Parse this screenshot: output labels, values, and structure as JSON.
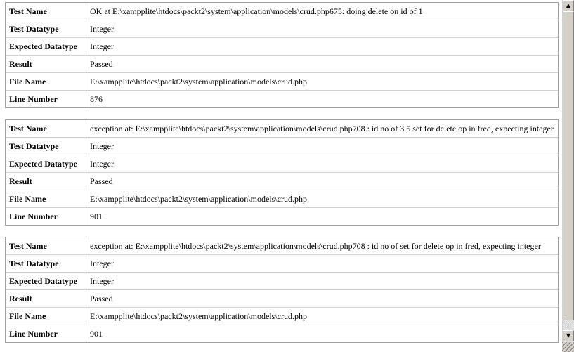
{
  "labels": {
    "test_name": "Test Name",
    "test_datatype": "Test Datatype",
    "expected_datatype": "Expected Datatype",
    "result": "Result",
    "file_name": "File Name",
    "line_number": "Line Number"
  },
  "results": [
    {
      "test_name": "OK at E:\\xampplite\\htdocs\\packt2\\system\\application\\models\\crud.php675: doing delete on id of 1",
      "test_datatype": "Integer",
      "expected_datatype": "Integer",
      "result": "Passed",
      "file_name": "E:\\xampplite\\htdocs\\packt2\\system\\application\\models\\crud.php",
      "line_number": "876"
    },
    {
      "test_name": "exception at: E:\\xampplite\\htdocs\\packt2\\system\\application\\models\\crud.php708 : id no of 3.5 set for delete op in fred, expecting integer",
      "test_datatype": "Integer",
      "expected_datatype": "Integer",
      "result": "Passed",
      "file_name": "E:\\xampplite\\htdocs\\packt2\\system\\application\\models\\crud.php",
      "line_number": "901"
    },
    {
      "test_name": "exception at: E:\\xampplite\\htdocs\\packt2\\system\\application\\models\\crud.php708 : id no of set for delete op in fred, expecting integer",
      "test_datatype": "Integer",
      "expected_datatype": "Integer",
      "result": "Passed",
      "file_name": "E:\\xampplite\\htdocs\\packt2\\system\\application\\models\\crud.php",
      "line_number": "901"
    }
  ],
  "scrollbar": {
    "up_arrow_icon": "triangle-up",
    "down_arrow_icon": "triangle-down"
  }
}
